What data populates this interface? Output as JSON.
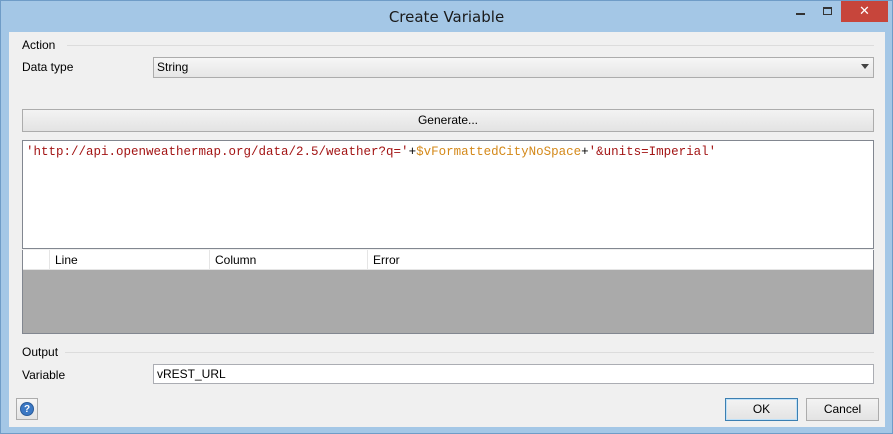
{
  "window": {
    "title": "Create Variable",
    "minimize_glyph": "",
    "maximize_glyph": "",
    "close_glyph": "✕"
  },
  "action": {
    "group_label": "Action",
    "data_type_label": "Data type",
    "data_type_value": "String",
    "generate_label": "Generate..."
  },
  "editor": {
    "tokens": [
      {
        "type": "string",
        "text": "'http://api.openweathermap.org/data/2.5/weather?q='"
      },
      {
        "type": "plus",
        "text": "+"
      },
      {
        "type": "variable",
        "text": "$vFormattedCityNoSpace"
      },
      {
        "type": "plus",
        "text": "+"
      },
      {
        "type": "string",
        "text": "'&units=Imperial'"
      }
    ]
  },
  "errors_grid": {
    "columns": [
      "",
      "Line",
      "Column",
      "Error"
    ],
    "rows": []
  },
  "output": {
    "group_label": "Output",
    "variable_label": "Variable",
    "variable_value": "vREST_URL"
  },
  "buttons": {
    "help_glyph": "?",
    "ok_label": "OK",
    "cancel_label": "Cancel"
  },
  "colors": {
    "string": "#a31515",
    "variable": "#d4891a",
    "close_button": "#c7453b",
    "grid_empty": "#aaaaaa"
  }
}
